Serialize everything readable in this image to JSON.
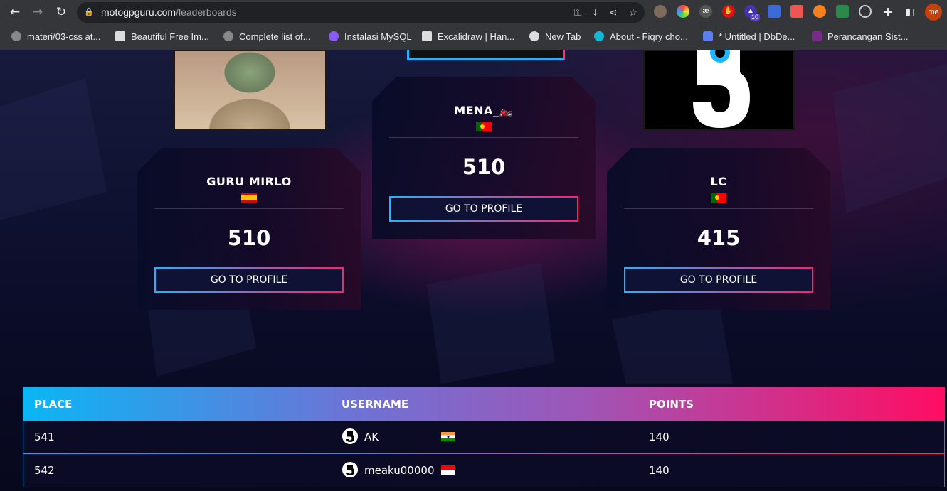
{
  "browser": {
    "url_host": "motogpguru.com",
    "url_path": "/leaderboards",
    "extension_badge": "10",
    "profile_initials": "me",
    "bookmarks": [
      {
        "label": "materi/03-css at...",
        "icon": "github-icon"
      },
      {
        "label": "Beautiful Free Im...",
        "icon": "unsplash-icon"
      },
      {
        "label": "Complete list of...",
        "icon": "github-icon"
      },
      {
        "label": "Instalasi MySQL",
        "icon": "gitbook-icon"
      },
      {
        "label": "Excalidraw | Han...",
        "icon": "excalidraw-icon"
      },
      {
        "label": "New Tab",
        "icon": "globe-icon"
      },
      {
        "label": "About - Fiqry cho...",
        "icon": "site-icon"
      },
      {
        "label": "* Untitled | DbDe...",
        "icon": "dbdesigner-icon"
      },
      {
        "label": "Perancangan Sist...",
        "icon": "site-icon"
      }
    ]
  },
  "podium": [
    {
      "name": "GURU MIRLO",
      "flag": "spain",
      "points": "510",
      "button": "GO TO PROFILE"
    },
    {
      "name": "MENA_🏍️",
      "flag": "portugal",
      "points": "510",
      "button": "GO TO PROFILE"
    },
    {
      "name": "LC",
      "flag": "portugal",
      "points": "415",
      "button": "GO TO PROFILE"
    }
  ],
  "table": {
    "headers": [
      "PLACE",
      "USERNAME",
      "POINTS"
    ],
    "rows": [
      {
        "place": "541",
        "username": "AK",
        "flag": "india",
        "points": "140"
      },
      {
        "place": "542",
        "username": "meaku00000",
        "flag": "indonesia",
        "points": "140"
      }
    ]
  },
  "colors": {
    "accent_cyan": "#1fb6ff",
    "accent_pink": "#ff1f6d"
  }
}
